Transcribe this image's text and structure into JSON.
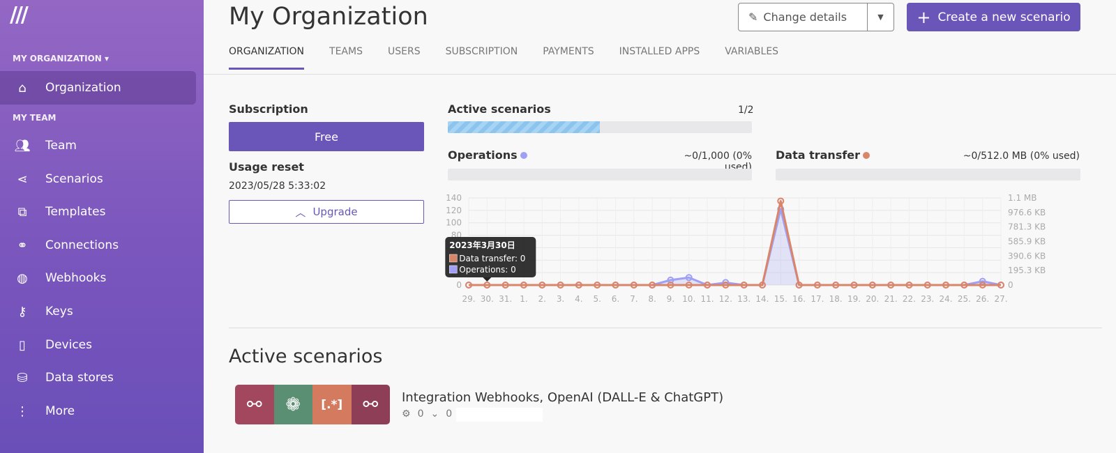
{
  "sidebar": {
    "org_label": "MY ORGANIZATION ▾",
    "team_label": "MY TEAM",
    "items": [
      {
        "label": "Organization",
        "icon": "home-icon"
      },
      {
        "label": "Team",
        "icon": "users-icon"
      },
      {
        "label": "Scenarios",
        "icon": "share-icon"
      },
      {
        "label": "Templates",
        "icon": "puzzle-icon"
      },
      {
        "label": "Connections",
        "icon": "link-icon"
      },
      {
        "label": "Webhooks",
        "icon": "globe-icon"
      },
      {
        "label": "Keys",
        "icon": "key-icon"
      },
      {
        "label": "Devices",
        "icon": "phone-icon"
      },
      {
        "label": "Data stores",
        "icon": "database-icon"
      },
      {
        "label": "More",
        "icon": "more-vertical-icon"
      }
    ]
  },
  "header": {
    "title": "My Organization",
    "change_details": "Change details",
    "create": "Create a new scenario"
  },
  "tabs": [
    "ORGANIZATION",
    "TEAMS",
    "USERS",
    "SUBSCRIPTION",
    "PAYMENTS",
    "INSTALLED APPS",
    "VARIABLES"
  ],
  "subscription": {
    "title": "Subscription",
    "plan": "Free",
    "usage_reset_title": "Usage reset",
    "usage_reset": "2023/05/28 5:33:02",
    "upgrade": "Upgrade"
  },
  "active": {
    "title": "Active scenarios",
    "value": "1/2",
    "fraction": 0.5
  },
  "operations": {
    "title": "Operations",
    "value": "~0/1,000 (0% used)",
    "color": "#9f9ff5",
    "fraction": 0
  },
  "transfer": {
    "title": "Data transfer",
    "value": "~0/512.0 MB (0% used)",
    "color": "#d9856a",
    "fraction": 0
  },
  "chart_data": {
    "type": "line",
    "categories": [
      "29.",
      "30.",
      "31.",
      "1.",
      "2.",
      "3.",
      "4.",
      "5.",
      "6.",
      "7.",
      "8.",
      "9.",
      "10.",
      "11.",
      "12.",
      "13.",
      "14.",
      "15.",
      "16.",
      "17.",
      "18.",
      "19.",
      "20.",
      "21.",
      "22.",
      "23.",
      "24.",
      "25.",
      "26.",
      "27."
    ],
    "left_ticks": [
      "0",
      "20",
      "40",
      "60",
      "80",
      "100",
      "120",
      "140"
    ],
    "ylim": [
      0,
      140
    ],
    "right_ticks": [
      "0",
      "195.3 KB",
      "390.6 KB",
      "585.9 KB",
      "781.3 KB",
      "976.6 KB",
      "1.1 MB"
    ],
    "grid": true,
    "series": [
      {
        "name": "Operations",
        "axis": "left",
        "color": "#9f9ff5",
        "values": [
          0,
          0,
          0,
          0,
          0,
          0,
          0,
          0,
          0,
          0,
          0,
          8,
          12,
          0,
          4,
          0,
          0,
          122,
          0,
          0,
          0,
          0,
          0,
          0,
          0,
          0,
          0,
          0,
          6,
          0
        ]
      },
      {
        "name": "Data transfer",
        "axis": "left-scaled",
        "color": "#d9856a",
        "values": [
          0,
          0,
          0,
          0,
          0,
          0,
          0,
          0,
          0,
          0,
          0,
          0,
          0,
          0,
          0,
          0,
          0,
          135,
          0,
          0,
          0,
          0,
          0,
          0,
          0,
          0,
          0,
          0,
          0,
          0
        ]
      }
    ],
    "tooltip": {
      "title": "2023年3月30日",
      "lines": [
        "Data transfer: 0",
        "Operations: 0"
      ]
    }
  },
  "scenarios": {
    "title": "Active scenarios",
    "items": [
      {
        "name": "Integration Webhooks, OpenAI (DALL-E & ChatGPT)",
        "runs": "0",
        "ops": "0",
        "modules": [
          {
            "color": "#a3475f",
            "icon": "webhook-icon",
            "glyph": "⚯"
          },
          {
            "color": "#5b8f73",
            "icon": "openai-icon",
            "glyph": "❁"
          },
          {
            "color": "#d47a5f",
            "icon": "regex-icon",
            "glyph": "[.*]"
          },
          {
            "color": "#8e3e57",
            "icon": "webhook-icon",
            "glyph": "⚯"
          }
        ]
      }
    ]
  }
}
